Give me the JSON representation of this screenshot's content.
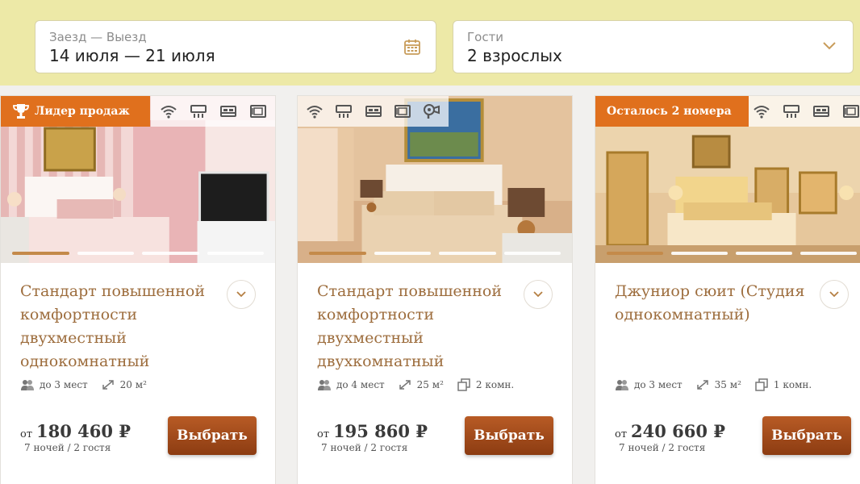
{
  "search": {
    "dates_label": "Заезд — Выезд",
    "dates_value": "14 июля — 21 июля",
    "guests_label": "Гости",
    "guests_value": "2 взрослых"
  },
  "colors": {
    "topbar": "#ede9a7",
    "accent": "#e0701d",
    "title": "#9d6d3d",
    "button": "#a0461a"
  },
  "cards": [
    {
      "badge": "Лидер продаж",
      "amenities": [
        "wifi-icon",
        "air-conditioner-icon",
        "bed-icon",
        "safe-icon"
      ],
      "title": "Стандарт повышенной комфортности двухместный однокомнатный",
      "guests": "до 3 мест",
      "area": "20 м²",
      "rooms": "",
      "price_from": "от",
      "price": "180 460 ₽",
      "price_note": "7 ночей / 2 гостя",
      "button": "Выбрать"
    },
    {
      "badge": "",
      "amenities": [
        "wifi-icon",
        "air-conditioner-icon",
        "bed-icon",
        "safe-icon",
        "hairdryer-icon"
      ],
      "title": "Стандарт повышенной комфортности двухместный двухкомнатный",
      "guests": "до 4 мест",
      "area": "25 м²",
      "rooms": "2 комн.",
      "price_from": "от",
      "price": "195 860 ₽",
      "price_note": "7 ночей / 2 гостя",
      "button": "Выбрать"
    },
    {
      "badge": "Осталось 2 номера",
      "amenities": [
        "wifi-icon",
        "air-conditioner-icon",
        "bed-icon",
        "safe-icon"
      ],
      "title": "Джуниор сюит (Студия однокомнатный)",
      "guests": "до 3 мест",
      "area": "35 м²",
      "rooms": "1 комн.",
      "price_from": "от",
      "price": "240 660 ₽",
      "price_note": "7 ночей / 2 гостя",
      "button": "Выбрать"
    }
  ]
}
